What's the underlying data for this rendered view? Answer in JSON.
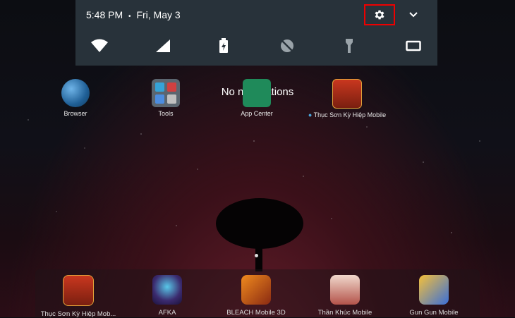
{
  "status": {
    "time": "5:48 PM",
    "separator": "•",
    "date": "Fri, May 3"
  },
  "notifications": {
    "empty_text": "No notifications"
  },
  "quick_settings": [
    "wifi-icon",
    "cellular-signal-icon",
    "battery-charging-icon",
    "location-off-icon",
    "flashlight-icon",
    "screen-cast-icon"
  ],
  "desktop_apps": [
    {
      "label": "Browser",
      "icon": "globe-icon"
    },
    {
      "label": "Tools",
      "icon": "tools-folder-icon"
    },
    {
      "label": "App Center",
      "icon": "app-center-icon"
    },
    {
      "label": "Thục Sơn Kỳ Hiệp Mobile",
      "icon": "game-icon"
    }
  ],
  "dock_apps": [
    {
      "label": "Thục Sơn Kỳ Hiệp Mob..."
    },
    {
      "label": "AFKA"
    },
    {
      "label": "BLEACH Mobile 3D"
    },
    {
      "label": "Thần Khúc Mobile"
    },
    {
      "label": "Gun Gun Mobile"
    }
  ],
  "colors": {
    "panel": "#28323a",
    "highlight": "#ee0000",
    "text": "#ffffff"
  }
}
